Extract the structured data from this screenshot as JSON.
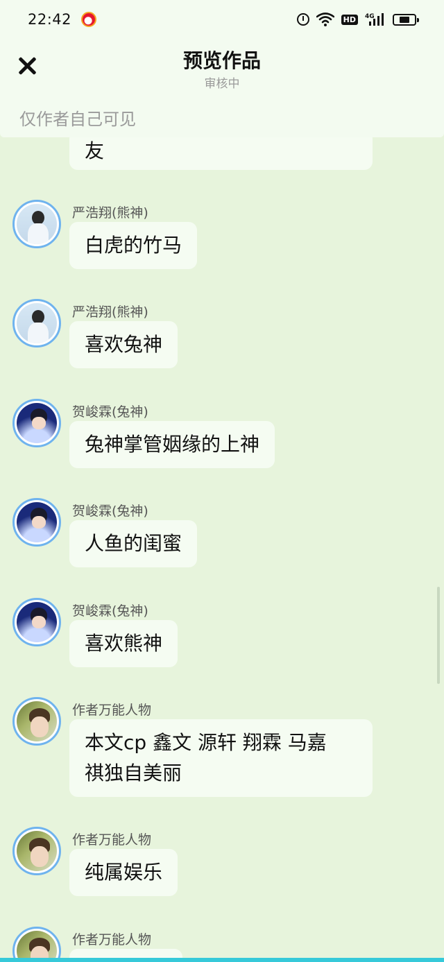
{
  "status_bar": {
    "time": "22:42",
    "icons": [
      "weibo-icon",
      "alarm-icon",
      "wifi-icon",
      "hd-icon",
      "signal-icon",
      "battery-icon"
    ],
    "hd_label": "HD",
    "network_label": "4G"
  },
  "header": {
    "title": "预览作品",
    "subtitle": "审核中",
    "visibility_note": "仅作者自己可见",
    "close_icon": "close-icon"
  },
  "partial_top_message": {
    "text": "友"
  },
  "messages": [
    {
      "name": "严浩翔(熊神)",
      "avatar": "yan",
      "text": "白虎的竹马"
    },
    {
      "name": "严浩翔(熊神)",
      "avatar": "yan",
      "text": "喜欢兔神"
    },
    {
      "name": "贺峻霖(兔神)",
      "avatar": "he",
      "text": "兔神掌管姻缘的上神"
    },
    {
      "name": "贺峻霖(兔神)",
      "avatar": "he",
      "text": "人鱼的闺蜜"
    },
    {
      "name": "贺峻霖(兔神)",
      "avatar": "he",
      "text": "喜欢熊神"
    },
    {
      "name": "作者万能人物",
      "avatar": "author",
      "text_line1": "本文cp 鑫文 源轩 翔霖 马嘉",
      "text_line2": "祺独自美丽"
    },
    {
      "name": "作者万能人物",
      "avatar": "author",
      "text": "纯属娱乐"
    },
    {
      "name": "作者万能人物",
      "avatar": "author",
      "text": ""
    }
  ],
  "colors": {
    "background": "#e7f4dc",
    "header": "#f3fbf0",
    "bubble": "#f5fcf2",
    "avatar_ring": "#6fb3ee",
    "bottom_bar": "#36c9d9"
  }
}
